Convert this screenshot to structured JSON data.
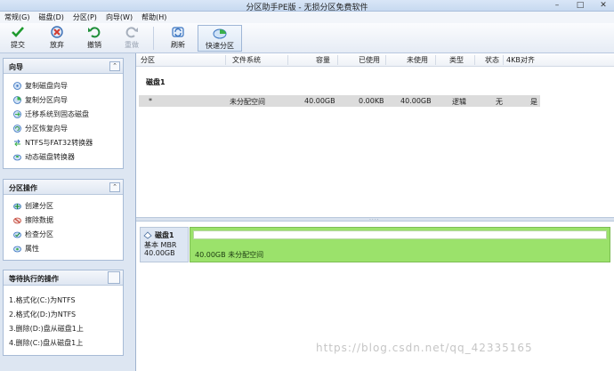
{
  "window": {
    "title": "分区助手PE版 - 无损分区免费软件"
  },
  "menu": [
    "常规(G)",
    "磁盘(D)",
    "分区(P)",
    "向导(W)",
    "帮助(H)"
  ],
  "toolbar": {
    "commit": "提交",
    "discard": "放弃",
    "undo": "撤销",
    "redo": "重做",
    "refresh": "刷新",
    "quick_partition": "快速分区"
  },
  "wizard_panel": {
    "title": "向导",
    "items": [
      "复制磁盘向导",
      "复制分区向导",
      "迁移系统到固态磁盘",
      "分区恢复向导",
      "NTFS与FAT32转换器",
      "动态磁盘转换器"
    ]
  },
  "partition_panel": {
    "title": "分区操作",
    "items": [
      "创建分区",
      "擦除数据",
      "检查分区",
      "属性"
    ]
  },
  "pending_panel": {
    "title": "等待执行的操作",
    "items": [
      "1.格式化(C:)为NTFS",
      "2.格式化(D:)为NTFS",
      "3.删除(D:)盘从磁盘1上",
      "4.删除(C:)盘从磁盘1上"
    ]
  },
  "table": {
    "columns": [
      "分区",
      "文件系统",
      "容量",
      "已使用",
      "未使用",
      "类型",
      "状态",
      "4KB对齐"
    ],
    "disk_label": "磁盘1",
    "row": [
      "*",
      "未分配空间",
      "40.00GB",
      "0.00KB",
      "40.00GB",
      "逻辑",
      "无",
      "是"
    ]
  },
  "disk_map": {
    "name": "磁盘1",
    "type": "基本 MBR",
    "size": "40.00GB",
    "partition_label": "40.00GB 未分配空间"
  },
  "watermark": "https://blog.csdn.net/qq_42335165",
  "colors": {
    "unallocated_fill": "#9be26b",
    "accent": "#2f6db6"
  }
}
